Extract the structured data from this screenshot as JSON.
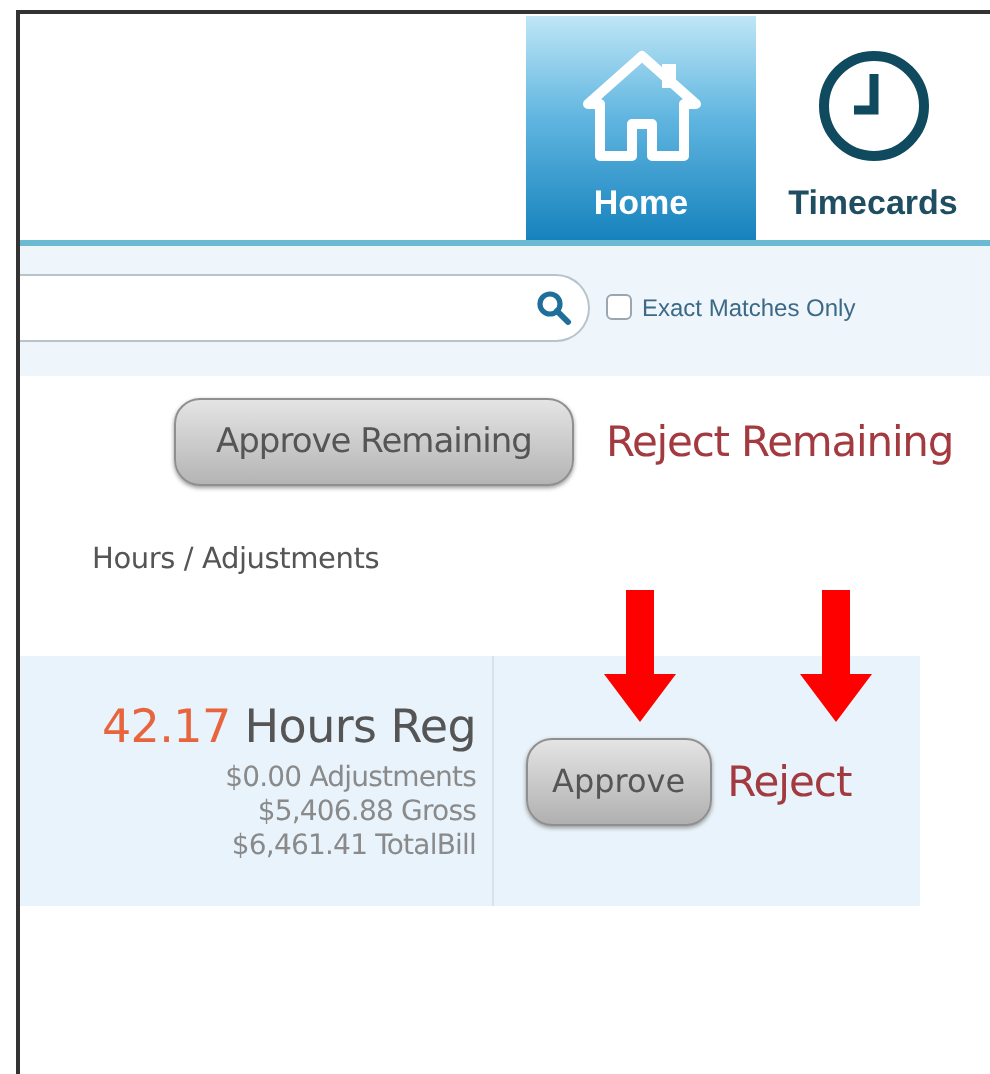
{
  "nav_tabs": [
    {
      "label": "Home",
      "kind": "house",
      "selected": true
    },
    {
      "label": "Timecards",
      "kind": "clock",
      "selected": false
    }
  ],
  "search": {
    "exact_matches_only": {
      "label": "Exact Matches Only",
      "checked": false
    }
  },
  "bulk_actions": {
    "approve": "Approve Remaining",
    "reject": "Reject Remaining"
  },
  "column_header": "Hours / Adjustments",
  "rows": [
    {
      "hours": "42.17",
      "hours_label": "Hours Reg",
      "adjustments": "$0.00 Adjustments",
      "gross": "$5,406.88 Gross",
      "total_bill": "$6,461.41 TotalBill",
      "approve": "Approve",
      "reject": "Reject"
    }
  ],
  "annotations": [
    {
      "kind": "down-arrow"
    },
    {
      "kind": "down-arrow"
    }
  ]
}
